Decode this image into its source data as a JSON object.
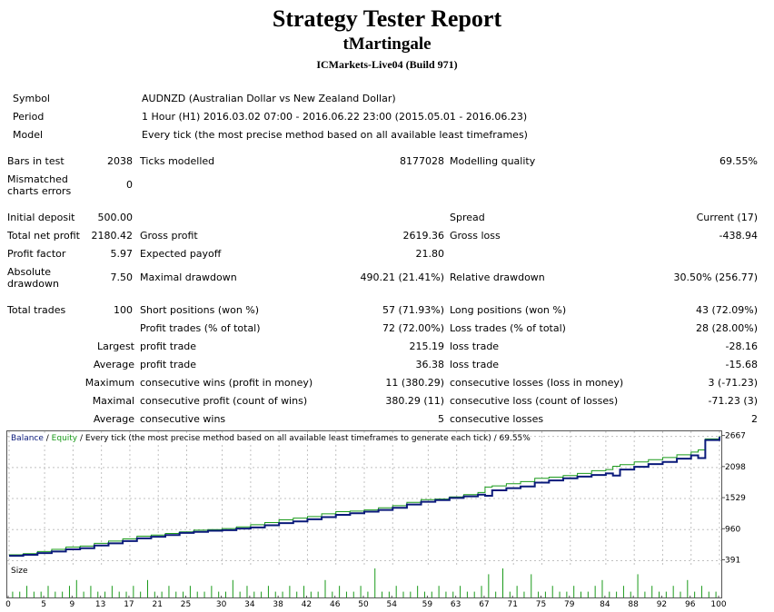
{
  "report": {
    "title": "Strategy Tester Report",
    "ea_name": "tMartingale",
    "server": "ICMarkets-Live04 (Build 971)"
  },
  "info": {
    "symbol_label": "Symbol",
    "symbol_value": "AUDNZD (Australian Dollar vs New Zealand Dollar)",
    "period_label": "Period",
    "period_value": "1 Hour (H1) 2016.03.02 07:00 - 2016.06.22 23:00 (2015.05.01 - 2016.06.23)",
    "model_label": "Model",
    "model_value": "Every tick (the most precise method based on all available least timeframes)"
  },
  "stats": {
    "bars_label": "Bars in test",
    "bars_value": "2038",
    "ticks_label": "Ticks modelled",
    "ticks_value": "8177028",
    "quality_label": "Modelling quality",
    "quality_value": "69.55%",
    "mismatch_label": "Mismatched charts errors",
    "mismatch_value": "0",
    "deposit_label": "Initial deposit",
    "deposit_value": "500.00",
    "spread_label": "Spread",
    "spread_value": "Current (17)",
    "net_label": "Total net profit",
    "net_value": "2180.42",
    "gross_profit_label": "Gross profit",
    "gross_profit_value": "2619.36",
    "gross_loss_label": "Gross loss",
    "gross_loss_value": "-438.94",
    "pf_label": "Profit factor",
    "pf_value": "5.97",
    "payoff_label": "Expected payoff",
    "payoff_value": "21.80",
    "abs_dd_label": "Absolute drawdown",
    "abs_dd_value": "7.50",
    "max_dd_label": "Maximal drawdown",
    "max_dd_value": "490.21 (21.41%)",
    "rel_dd_label": "Relative drawdown",
    "rel_dd_value": "30.50% (256.77)",
    "trades_label": "Total trades",
    "trades_value": "100",
    "short_label": "Short positions (won %)",
    "short_value": "57 (71.93%)",
    "long_label": "Long positions (won %)",
    "long_value": "43 (72.09%)",
    "ptrades_label": "Profit trades (% of total)",
    "ptrades_value": "72 (72.00%)",
    "ltrades_label": "Loss trades (% of total)",
    "ltrades_value": "28 (28.00%)",
    "largest": "Largest",
    "average": "Average",
    "maximum": "Maximum",
    "maximal": "Maximal",
    "profit_trade": "profit trade",
    "loss_trade": "loss trade",
    "largest_profit": "215.19",
    "largest_loss": "-28.16",
    "average_profit": "36.38",
    "average_loss": "-15.68",
    "cons_wins_label": "consecutive wins (profit in money)",
    "cons_wins_value": "11 (380.29)",
    "cons_losses_label": "consecutive losses (loss in money)",
    "cons_losses_value": "3 (-71.23)",
    "cons_profit_label": "consecutive profit (count of wins)",
    "cons_profit_value": "380.29 (11)",
    "cons_loss_label": "consecutive loss (count of losses)",
    "cons_loss_value": "-71.23 (3)",
    "avg_wins_label": "consecutive wins",
    "avg_wins_value": "5",
    "avg_losses_label": "consecutive losses",
    "avg_losses_value": "2"
  },
  "chart_data": {
    "type": "line",
    "legend": {
      "balance": "Balance",
      "sep1": " / ",
      "equity": "Equity",
      "sep2": " / ",
      "rest": "Every tick (the most precise method based on all available least timeframes to generate each tick) / 69.55%"
    },
    "colors": {
      "balance": "#0a1a7a",
      "equity": "#1a9a1a",
      "size": "#1a9a1a",
      "grid": "#c0c0c0"
    },
    "ylim": [
      300,
      2760
    ],
    "y_ticks": [
      2667,
      2098,
      1529,
      960,
      391
    ],
    "x_ticks": [
      0,
      5,
      9,
      13,
      17,
      21,
      25,
      30,
      34,
      38,
      42,
      46,
      50,
      54,
      59,
      63,
      67,
      71,
      75,
      79,
      84,
      88,
      92,
      96,
      100
    ],
    "xlim": [
      0,
      100
    ],
    "size_label": "Size",
    "series": [
      {
        "name": "Balance",
        "x": [
          0,
          2,
          4,
          6,
          8,
          10,
          12,
          14,
          16,
          18,
          20,
          22,
          24,
          26,
          28,
          30,
          32,
          34,
          36,
          38,
          40,
          42,
          44,
          46,
          48,
          50,
          52,
          54,
          56,
          58,
          60,
          62,
          64,
          66,
          67,
          68,
          70,
          72,
          74,
          76,
          78,
          80,
          82,
          84,
          85,
          86,
          88,
          90,
          92,
          94,
          96,
          97,
          98,
          100
        ],
        "values": [
          480,
          500,
          530,
          560,
          600,
          620,
          670,
          710,
          750,
          800,
          830,
          860,
          900,
          920,
          940,
          950,
          980,
          1000,
          1040,
          1080,
          1110,
          1150,
          1190,
          1230,
          1260,
          1290,
          1320,
          1360,
          1420,
          1470,
          1500,
          1540,
          1570,
          1600,
          1580,
          1680,
          1720,
          1750,
          1820,
          1860,
          1900,
          1930,
          1960,
          1990,
          1950,
          2060,
          2110,
          2160,
          2200,
          2260,
          2320,
          2270,
          2600,
          2660
        ]
      },
      {
        "name": "Equity",
        "x": [
          0,
          2,
          4,
          6,
          8,
          10,
          12,
          14,
          16,
          18,
          20,
          22,
          24,
          26,
          28,
          30,
          32,
          34,
          36,
          38,
          40,
          42,
          44,
          46,
          48,
          50,
          52,
          54,
          56,
          58,
          60,
          62,
          64,
          66,
          67,
          68,
          70,
          72,
          74,
          76,
          78,
          80,
          82,
          84,
          85,
          86,
          88,
          90,
          92,
          94,
          96,
          97,
          98,
          100
        ],
        "values": [
          500,
          520,
          560,
          600,
          640,
          660,
          710,
          750,
          790,
          840,
          860,
          890,
          920,
          950,
          960,
          980,
          1010,
          1050,
          1090,
          1140,
          1170,
          1200,
          1250,
          1290,
          1300,
          1320,
          1360,
          1400,
          1460,
          1510,
          1520,
          1560,
          1600,
          1640,
          1740,
          1760,
          1800,
          1840,
          1900,
          1920,
          1950,
          1990,
          2040,
          2060,
          2120,
          2150,
          2200,
          2240,
          2280,
          2330,
          2380,
          2420,
          2620,
          2680
        ]
      }
    ],
    "size_values": [
      1,
      1,
      2,
      1,
      1,
      2,
      1,
      1,
      2,
      3,
      1,
      2,
      1,
      1,
      2,
      1,
      1,
      2,
      1,
      3,
      1,
      1,
      2,
      1,
      1,
      2,
      1,
      1,
      2,
      1,
      1,
      3,
      1,
      2,
      1,
      1,
      2,
      1,
      1,
      2,
      1,
      2,
      1,
      1,
      3,
      1,
      2,
      1,
      1,
      2,
      1,
      5,
      1,
      1,
      2,
      1,
      1,
      2,
      1,
      1,
      2,
      1,
      1,
      2,
      1,
      1,
      2,
      4,
      1,
      5,
      1,
      2,
      1,
      4,
      1,
      1,
      2,
      1,
      1,
      2,
      1,
      1,
      2,
      3,
      1,
      1,
      2,
      1,
      4,
      1,
      2,
      1,
      1,
      2,
      1,
      3,
      1,
      2,
      1,
      1
    ]
  }
}
